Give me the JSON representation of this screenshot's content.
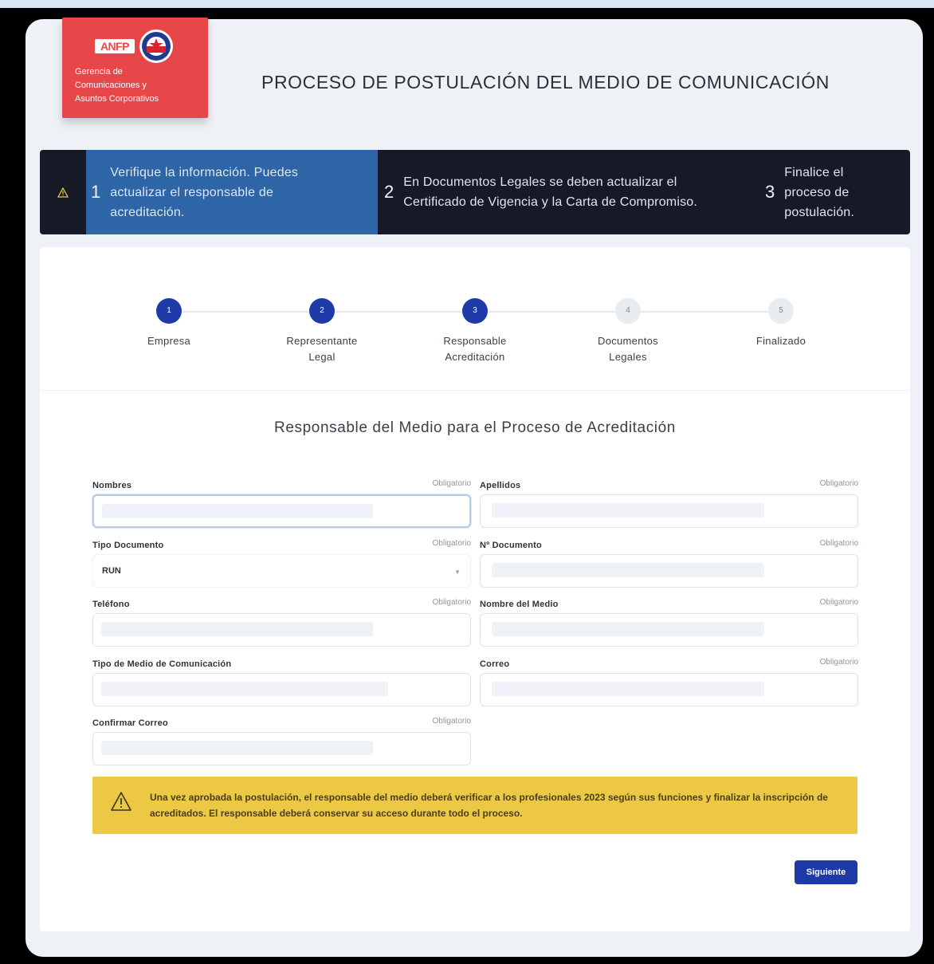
{
  "header": {
    "logo_badge": "ANFP",
    "logo_text_line1": "Gerencia de",
    "logo_text_line2": "Comunicaciones y",
    "logo_text_line3": "Asuntos Corporativos",
    "title": "PROCESO DE POSTULACIÓN DEL MEDIO DE COMUNICACIÓN"
  },
  "banner": {
    "steps": [
      {
        "number": "1",
        "text": "Verifique la información. Puedes actualizar el responsable de acreditación."
      },
      {
        "number": "2",
        "text": "En Documentos Legales se deben actualizar el Certificado de Vigencia y la Carta de Compromiso."
      },
      {
        "number": "3",
        "text": "Finalice el proceso de postulación."
      }
    ]
  },
  "stepper": {
    "steps": [
      {
        "number": "1",
        "label": "Empresa",
        "state": "active"
      },
      {
        "number": "2",
        "label": "Representante Legal",
        "state": "active"
      },
      {
        "number": "3",
        "label": "Responsable Acreditación",
        "state": "active"
      },
      {
        "number": "4",
        "label": "Documentos Legales",
        "state": "inactive"
      },
      {
        "number": "5",
        "label": "Finalizado",
        "state": "inactive"
      }
    ]
  },
  "form": {
    "section_title": "Responsable del Medio para el Proceso de Acreditación",
    "required_label": "Obligatorio",
    "fields": {
      "nombres": {
        "label": "Nombres",
        "value": ""
      },
      "apellidos": {
        "label": "Apellidos",
        "value": ""
      },
      "tipo_documento": {
        "label": "Tipo Documento",
        "value": "RUN"
      },
      "numero_documento": {
        "label": "Nº Documento",
        "value": ""
      },
      "telefono": {
        "label": "Teléfono",
        "value": ""
      },
      "nombre_medio": {
        "label": "Nombre del Medio",
        "value": ""
      },
      "tipo_medio": {
        "label": "Tipo de Medio de Comunicación",
        "value": ""
      },
      "correo": {
        "label": "Correo",
        "value": ""
      },
      "confirmar_correo": {
        "label": "Confirmar Correo",
        "value": ""
      }
    }
  },
  "alert": {
    "text": "Una vez aprobada la postulación, el responsable del medio deberá verificar a los profesionales 2023 según sus funciones y finalizar la inscripción de acreditados. El responsable deberá conservar su acceso durante todo el proceso."
  },
  "actions": {
    "next_label": "Siguiente"
  },
  "colors": {
    "brand_red": "#e8474a",
    "primary_blue": "#1d3aa7",
    "banner_highlight": "#2e65a6",
    "alert_yellow": "#ecc844"
  }
}
